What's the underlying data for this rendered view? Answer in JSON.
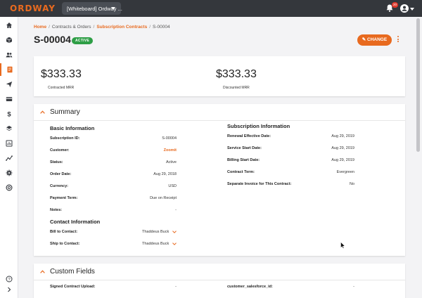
{
  "app": {
    "logo": "ORDWAY",
    "workspace": "[Whiteboard] Ordway ...",
    "notifications": "20"
  },
  "icons": {
    "sidebar": [
      "home-icon",
      "package-icon",
      "users-icon",
      "contract-icon",
      "send-icon",
      "card-icon",
      "dollar-icon",
      "layers-icon",
      "report-icon",
      "analytics-icon",
      "settings-icon",
      "support-icon",
      "help-icon",
      "expand-icon"
    ],
    "active": "contract-icon"
  },
  "colors": {
    "accent": "#e86a1f",
    "active_badge": "#2e9e46",
    "topbar": "#34373c"
  },
  "breadcrumb": {
    "home": "Home",
    "contracts": "Contracts & Orders",
    "subscription_contracts": "Subscription Contracts",
    "current": "S-00004"
  },
  "header": {
    "title": "S-00004",
    "status": "ACTIVE",
    "change_label": "✎ CHANGE"
  },
  "mrr": {
    "contracted_value": "$333.33",
    "contracted_label": "Contracted MRR",
    "discounted_value": "$333.33",
    "discounted_label": "Discounted MRR"
  },
  "summary": {
    "title": "Summary",
    "basic_title": "Basic Information",
    "basic": [
      {
        "k": "Subscription ID:",
        "v": "S-00004"
      },
      {
        "k": "Customer:",
        "v": "Zoomit"
      },
      {
        "k": "Status:",
        "v": "Active"
      },
      {
        "k": "Order Date:",
        "v": "Aug 29, 2018"
      },
      {
        "k": "Currency:",
        "v": "USD"
      },
      {
        "k": "Payment Term:",
        "v": "Due on Receipt"
      },
      {
        "k": "Notes:",
        "v": "-"
      }
    ],
    "contact_title": "Contact Information",
    "contacts": [
      {
        "k": "Bill to Contact:",
        "v": "Thaddeus Buck"
      },
      {
        "k": "Ship to Contact:",
        "v": "Thaddeus Buck"
      }
    ],
    "sub_title": "Subscription Information",
    "sub": [
      {
        "k": "Renewal Effective Date:",
        "v": "Aug 29, 2019"
      },
      {
        "k": "Service Start Date:",
        "v": "Aug 29, 2019"
      },
      {
        "k": "Billing Start Date:",
        "v": "Aug 29, 2019"
      },
      {
        "k": "Contract Term:",
        "v": "Evergreen"
      },
      {
        "k": "Separate Invoice for This Contract:",
        "v": "No"
      }
    ]
  },
  "custom": {
    "title": "Custom Fields",
    "fields": [
      {
        "k": "Signed Contract Upload:",
        "v": "-"
      },
      {
        "k": "customer_salesforce_id:",
        "v": "-"
      }
    ]
  }
}
